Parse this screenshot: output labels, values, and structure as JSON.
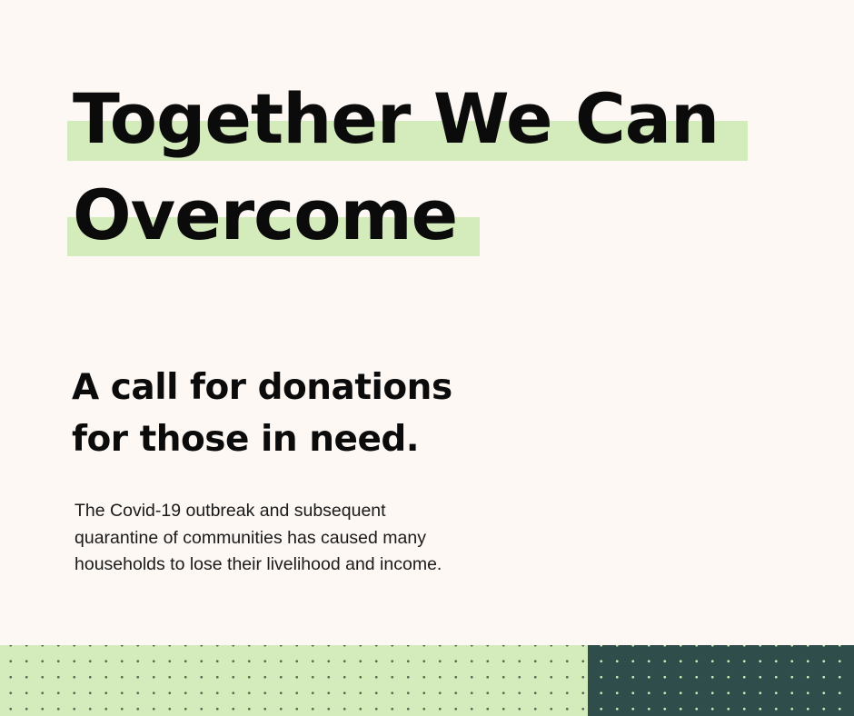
{
  "headline": {
    "line1": "Together We Can",
    "line2": "Overcome"
  },
  "subtitle": {
    "line1": "A call for donations",
    "line2": "for those in need."
  },
  "body": {
    "line1": "The Covid-19 outbreak and subsequent",
    "line2": "quarantine of communities has caused many",
    "line3": "households to lose their livelihood and income."
  },
  "colors": {
    "background": "#fdf8f4",
    "highlight": "#d4ebbb",
    "dark_green": "#2f4d4a",
    "text": "#0b0b0b"
  }
}
